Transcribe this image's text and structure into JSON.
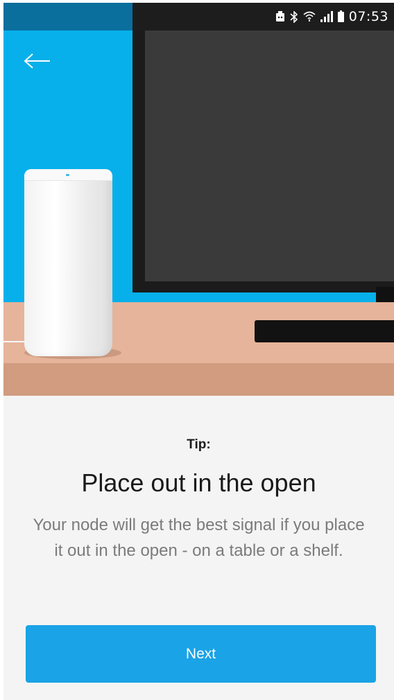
{
  "status_bar": {
    "time": "07:53",
    "icons": [
      "android-debug-icon",
      "bluetooth-icon",
      "wifi-icon",
      "cell-signal-icon",
      "battery-icon"
    ]
  },
  "header": {
    "back_icon": "arrow-left-icon"
  },
  "tip": {
    "label": "Tip:",
    "title": "Place out in the open",
    "body": "Your node will get the best signal if you place it out in the open - on a table or a shelf."
  },
  "actions": {
    "next_label": "Next"
  },
  "colors": {
    "accent": "#1aa3e6",
    "hero_background": "#07b0ea",
    "page_background": "#f4f4f4"
  }
}
